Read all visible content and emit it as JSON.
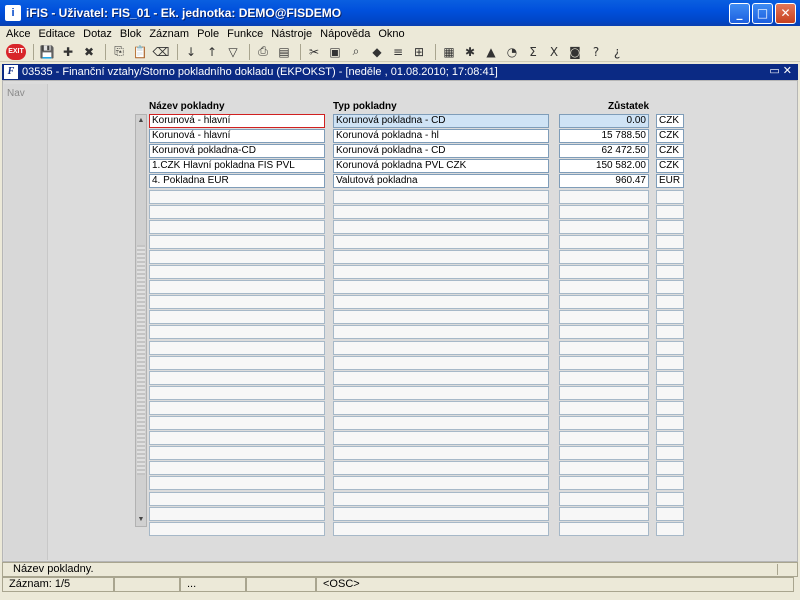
{
  "window": {
    "title": "iFIS - Uživatel: FIS_01 - Ek. jednotka: DEMO@FISDEMO",
    "app_icon": "iFIS-logo-icon",
    "buttons": [
      "minimize",
      "maximize",
      "close"
    ]
  },
  "menu": [
    "Akce",
    "Editace",
    "Dotaz",
    "Blok",
    "Záznam",
    "Pole",
    "Funkce",
    "Nástroje",
    "Nápověda",
    "Okno"
  ],
  "toolbar": {
    "exit_label": "EXIT",
    "icons": [
      "save-icon",
      "new-record-icon",
      "delete-record-icon",
      "clear-icon",
      "copy-icon",
      "paste-icon",
      "clear-block-icon",
      "sort-asc-icon",
      "sort-desc-icon",
      "filter-icon",
      "print-icon",
      "print-preview-icon",
      "cut-icon",
      "lock-icon",
      "find-icon",
      "first-icon",
      "last-icon",
      "calculator-icon",
      "tools-icon",
      "chart-icon",
      "clock-icon",
      "sum-icon",
      "excel-icon",
      "export-icon",
      "help-icon",
      "whats-this-icon"
    ]
  },
  "form": {
    "title": "03535 - Finanční vztahy/Storno pokladního dokladu (EKPOKST) - [neděle , 01.08.2010; 17:08:41]",
    "nav_label": "Nav",
    "headers": {
      "name": "Název pokladny",
      "type": "Typ pokladny",
      "balance": "Zůstatek"
    },
    "rows": [
      {
        "name": "Korunová - hlavní",
        "type": "Korunová pokladna - CD",
        "balance": "0.00",
        "currency": "CZK"
      },
      {
        "name": "Korunová - hlavní",
        "type": "Korunová pokladna - hl",
        "balance": "15 788.50",
        "currency": "CZK"
      },
      {
        "name": "Korunová pokladna-CD",
        "type": "Korunová pokladna - CD",
        "balance": "62 472.50",
        "currency": "CZK"
      },
      {
        "name": "1.CZK Hlavní pokladna FIS PVL",
        "type": "Korunová pokladna PVL CZK",
        "balance": "150 582.00",
        "currency": "CZK"
      },
      {
        "name": "4. Pokladna EUR",
        "type": "Valutová pokladna",
        "balance": "960.47",
        "currency": "EUR"
      }
    ],
    "empty_rows": 23
  },
  "status": {
    "hint": "Název pokladny.",
    "record": "Záznam: 1/5",
    "segment2": "",
    "segment3": "...",
    "segment4": "",
    "mode": "<OSC>"
  }
}
